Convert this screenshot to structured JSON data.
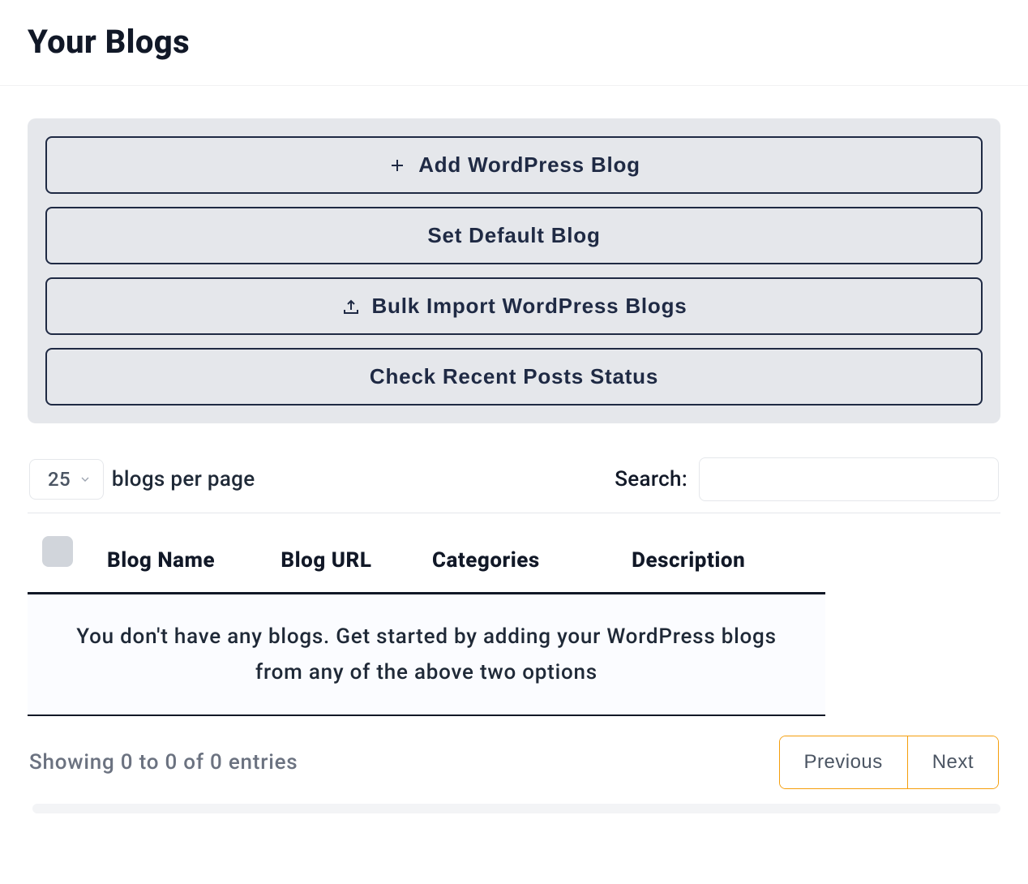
{
  "header": {
    "title": "Your Blogs"
  },
  "actions": {
    "add_label": "Add WordPress Blog",
    "set_default_label": "Set Default Blog",
    "bulk_import_label": "Bulk Import WordPress Blogs",
    "check_status_label": "Check Recent Posts Status"
  },
  "controls": {
    "per_page_value": "25",
    "per_page_suffix": "blogs per page",
    "search_label": "Search:",
    "search_value": ""
  },
  "table": {
    "columns": {
      "name": "Blog Name",
      "url": "Blog URL",
      "categories": "Categories",
      "description": "Description"
    },
    "empty_message": "You don't have any blogs. Get started by adding your WordPress blogs from any of the above two options"
  },
  "footer": {
    "showing": "Showing 0 to 0 of 0 entries",
    "previous": "Previous",
    "next": "Next"
  }
}
